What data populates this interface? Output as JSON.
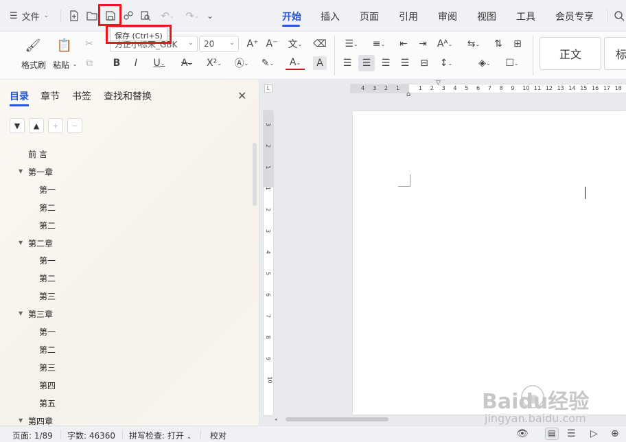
{
  "topbar": {
    "file_menu_label": "文件",
    "tabs": [
      {
        "label": "开始",
        "active": true
      },
      {
        "label": "插入",
        "active": false
      },
      {
        "label": "页面",
        "active": false
      },
      {
        "label": "引用",
        "active": false
      },
      {
        "label": "审阅",
        "active": false
      },
      {
        "label": "视图",
        "active": false
      },
      {
        "label": "工具",
        "active": false
      },
      {
        "label": "会员专享",
        "active": false
      }
    ]
  },
  "tooltip": {
    "text": "保存 (Ctrl+S)"
  },
  "ribbon": {
    "format_painter_label": "格式刷",
    "paste_label": "粘贴",
    "font_name": "方正小标宋_GBK",
    "font_size": "20",
    "style_normal": "正文",
    "style_heading_partial": "标"
  },
  "sidebar": {
    "tabs": [
      {
        "label": "目录",
        "active": true
      },
      {
        "label": "章节",
        "active": false
      },
      {
        "label": "书签",
        "active": false
      },
      {
        "label": "查找和替换",
        "active": false
      }
    ],
    "toc": [
      {
        "label": "前  言",
        "level": 1,
        "expandable": false
      },
      {
        "label": "第一章",
        "level": 1,
        "expandable": true
      },
      {
        "label": "第一",
        "level": 2
      },
      {
        "label": "第二",
        "level": 2
      },
      {
        "label": "第二",
        "level": 2
      },
      {
        "label": "第二章",
        "level": 1,
        "expandable": true
      },
      {
        "label": "第一",
        "level": 2
      },
      {
        "label": "第二",
        "level": 2
      },
      {
        "label": "第三",
        "level": 2
      },
      {
        "label": "第三章",
        "level": 1,
        "expandable": true
      },
      {
        "label": "第一",
        "level": 2
      },
      {
        "label": "第二",
        "level": 2
      },
      {
        "label": "第三",
        "level": 2
      },
      {
        "label": "第四",
        "level": 2
      },
      {
        "label": "第五",
        "level": 2
      },
      {
        "label": "第四章",
        "level": 1,
        "expandable": true
      }
    ]
  },
  "ruler": {
    "h_numbers": [
      "4",
      "3",
      "2",
      "1",
      "1",
      "2",
      "3",
      "4",
      "5",
      "6",
      "7",
      "8",
      "9",
      "10",
      "11",
      "12",
      "13",
      "14",
      "15",
      "16",
      "17",
      "18"
    ],
    "v_numbers": [
      "3",
      "2",
      "1",
      "1",
      "2",
      "3",
      "4",
      "5",
      "6",
      "7",
      "8",
      "9",
      "10"
    ]
  },
  "statusbar": {
    "page": "页面: 1/89",
    "word_count": "字数: 46360",
    "spell_check": "拼写检查: 打开",
    "proofread": "校对"
  },
  "watermark": {
    "brand": "Baidu经验",
    "url": "jingyan.baidu.com"
  },
  "colors": {
    "accent": "#2456d9",
    "highlight": "#e8171b"
  }
}
